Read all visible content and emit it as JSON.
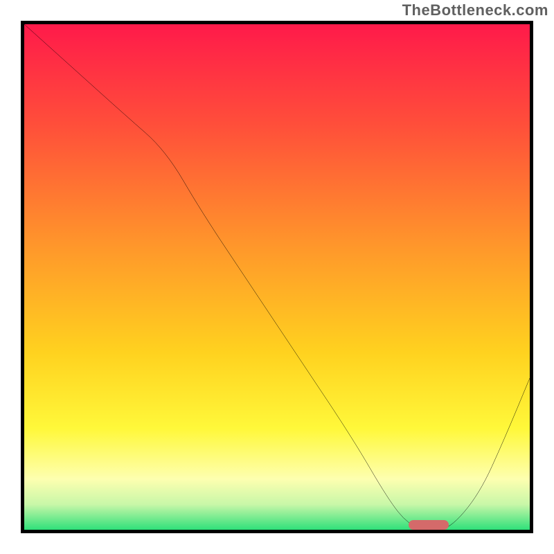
{
  "watermark": "TheBottleneck.com",
  "chart_data": {
    "type": "line",
    "title": "",
    "xlabel": "",
    "ylabel": "",
    "xlim": [
      0,
      100
    ],
    "ylim": [
      0,
      100
    ],
    "x": [
      0,
      10,
      20,
      28,
      35,
      45,
      55,
      65,
      72,
      76,
      80,
      84,
      90,
      95,
      100
    ],
    "values": [
      100,
      91,
      82,
      75,
      63,
      48,
      33,
      18,
      6,
      1,
      0,
      0,
      7,
      18,
      30
    ],
    "curve_note": "Piecewise: steep-ish slope from top-left, slight inflection near x≈28, nearly linear descent to a flat trough around x≈76–84, then a moderate rise to the right edge.",
    "marker": {
      "x_start": 76,
      "x_end": 84,
      "y": 1,
      "color": "#d46a6a"
    },
    "gradient_stops": [
      {
        "pct": 0,
        "color": "#ff1a4a"
      },
      {
        "pct": 20,
        "color": "#ff4f3a"
      },
      {
        "pct": 45,
        "color": "#ff9a2a"
      },
      {
        "pct": 65,
        "color": "#ffd21f"
      },
      {
        "pct": 80,
        "color": "#fff83a"
      },
      {
        "pct": 90,
        "color": "#fdffb0"
      },
      {
        "pct": 95,
        "color": "#c8f7a8"
      },
      {
        "pct": 100,
        "color": "#2fe07a"
      }
    ],
    "frame_color": "#000000",
    "curve_color": "#000000"
  }
}
